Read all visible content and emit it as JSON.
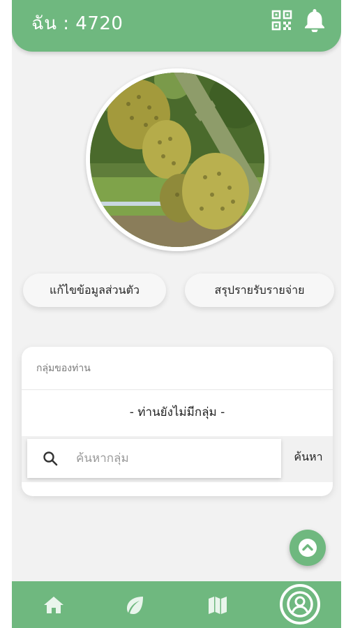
{
  "header": {
    "title": "ฉัน : 4720",
    "icons": [
      "qr-code-icon",
      "bell-icon"
    ]
  },
  "profile": {
    "photo": "durian-fruit-photo"
  },
  "actions": {
    "edit_profile_label": "แก้ไขข้อมูลส่วนตัว",
    "income_summary_label": "สรุปรายรับรายจ่าย"
  },
  "groups": {
    "label": "กลุ่มของท่าน",
    "empty_text": "- ท่านยังไม่มีกลุ่ม -",
    "search_placeholder": "ค้นหากลุ่ม",
    "search_value": "",
    "search_button_label": "ค้นหา"
  },
  "bottom_nav": {
    "items": [
      "home-icon",
      "leaf-icon",
      "map-icon",
      "profile-icon"
    ],
    "active": "profile-icon"
  },
  "colors": {
    "primary": "#6fb87f",
    "background": "#f2f2f2",
    "card": "#ffffff",
    "text": "#222222"
  }
}
